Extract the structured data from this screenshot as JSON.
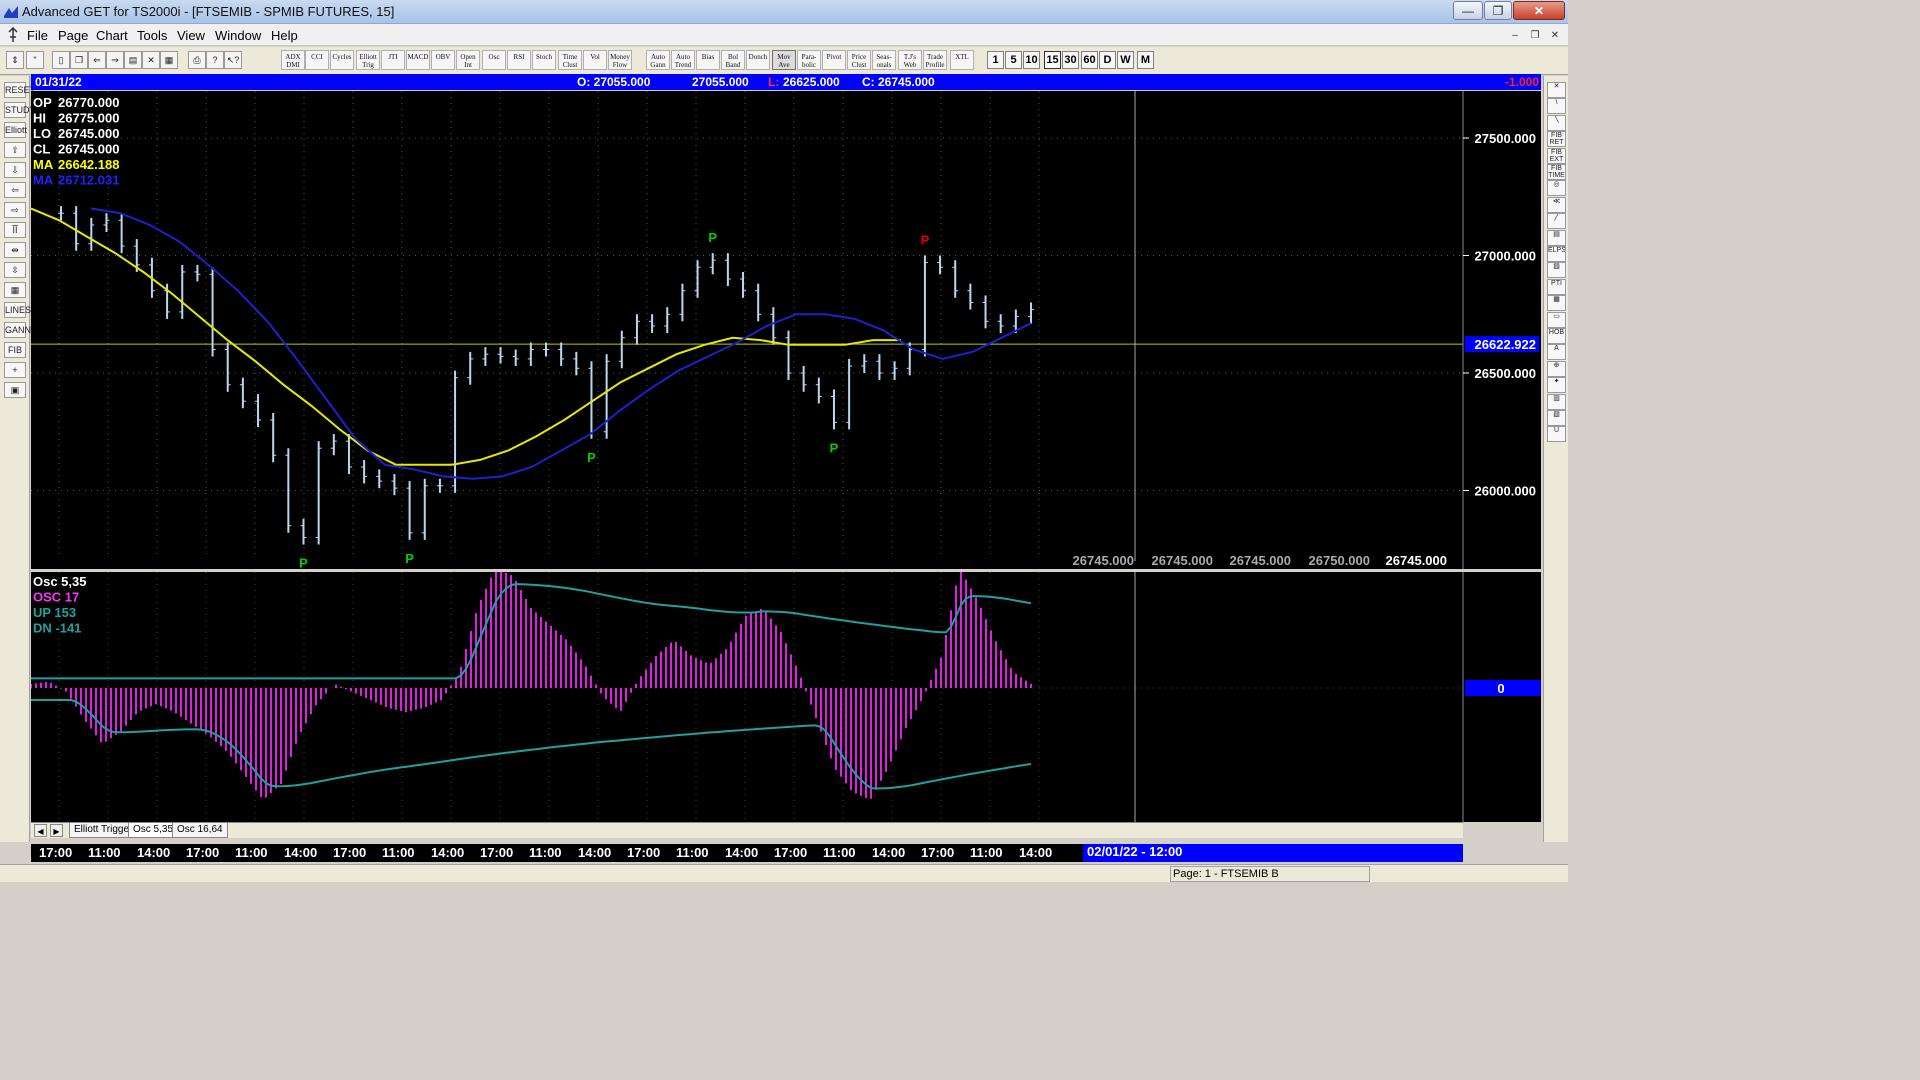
{
  "window": {
    "title": "Advanced GET for TS2000i - [FTSEMIB - SPMIB FUTURES, 15]",
    "minimize_label": "—",
    "maximize_label": "❐",
    "close_label": "✕"
  },
  "menu": {
    "items": [
      "File",
      "Page",
      "Chart",
      "Tools",
      "View",
      "Window",
      "Help"
    ],
    "mdi": [
      "–",
      "❐",
      "✕"
    ]
  },
  "toolbar": {
    "indicators": [
      "ADX DMI",
      "CCI",
      "Cycles",
      "Elliott Trig",
      "JTI",
      "MACD",
      "OBV",
      "Open Int",
      "Osc",
      "RSI",
      "Stoch",
      "Time Clust",
      "Vol",
      "Money Flow",
      "Auto Gann",
      "Auto Trend",
      "Bias",
      "Bol Band",
      "Donch",
      "Mov Ave",
      "Para-bolic",
      "Pivot",
      "Price Clust",
      "Seas-onals",
      "T.J's Web",
      "Trade Profile",
      "XTL"
    ],
    "active_indicator": "Mov Ave",
    "timeframes": [
      "1",
      "5",
      "10",
      "15",
      "30",
      "60",
      "D",
      "W",
      "M"
    ],
    "active_timeframe": "15"
  },
  "left_tools": [
    "RESET",
    "STUDY",
    "Elliott",
    "⇧",
    "⇩",
    "⇦",
    "⇨",
    "ĨĨ",
    "⇹",
    "⇳",
    "▦",
    "LINES",
    "GANN",
    "FIB",
    "+",
    "▣"
  ],
  "right_tools": [
    "✕",
    "\\",
    "╲",
    "FIB RET",
    "FIB EXT",
    "FIB TIME",
    "◎",
    "≪",
    "╱",
    "▤",
    "ELPS",
    "▨",
    "PTI",
    "▦",
    "▭",
    "HOB",
    "A",
    "⊕",
    "✦",
    "▥",
    "▧",
    "U"
  ],
  "infobar": {
    "date": "01/31/22",
    "open": "O: 27055.000",
    "high": "27055.000",
    "low_label": "L:",
    "low": "26625.000",
    "close": "C: 26745.000",
    "change": "-1.000",
    "change_color": "#ff2020"
  },
  "price_panel": {
    "legend": [
      {
        "label": "OP",
        "value": "26770.000",
        "color": "#ffffff"
      },
      {
        "label": "HI",
        "value": "26775.000",
        "color": "#ffffff"
      },
      {
        "label": "LO",
        "value": "26745.000",
        "color": "#ffffff"
      },
      {
        "label": "CL",
        "value": "26745.000",
        "color": "#ffffff"
      },
      {
        "label": "MA",
        "value": "26642.188",
        "color": "#ffff00"
      },
      {
        "label": "MA",
        "value": "26712.031",
        "color": "#2020ff"
      }
    ],
    "axis_labels": [
      "27500.000",
      "27000.000",
      "26500.000",
      "26000.000"
    ],
    "current_price": "26622.922",
    "bottom_values": [
      "26745.000",
      "26745.000",
      "26745.000",
      "26750.000",
      "26745.000"
    ],
    "pivots": [
      {
        "label": "P",
        "color": "#00d000"
      },
      {
        "label": "P",
        "color": "#00d000"
      },
      {
        "label": "P",
        "color": "#00d000"
      },
      {
        "label": "P",
        "color": "#00d000"
      },
      {
        "label": "P",
        "color": "#00d000"
      },
      {
        "label": "P",
        "color": "#e00000"
      }
    ]
  },
  "osc_panel": {
    "legend": [
      {
        "label": "Osc 5,35",
        "color": "#ffffff"
      },
      {
        "label": "OSC 17",
        "color": "#ff33ff"
      },
      {
        "label": "UP   153",
        "color": "#20a0a0"
      },
      {
        "label": "DN   -141",
        "color": "#20a0a0"
      }
    ],
    "zero_label": "0",
    "colors": {
      "histogram": "#e020e0",
      "bands": "#20a0a0"
    }
  },
  "tabs": {
    "nav": [
      "◀",
      "▶"
    ],
    "items": [
      "Elliott Trigger",
      "Osc 5,35",
      "Osc 16,64"
    ],
    "active": "Osc 5,35"
  },
  "time_axis": {
    "labels": [
      "17:00",
      "11:00",
      "14:00",
      "17:00",
      "11:00",
      "14:00",
      "17:00",
      "11:00",
      "14:00",
      "17:00",
      "11:00",
      "14:00",
      "17:00",
      "11:00",
      "14:00",
      "17:00",
      "11:00",
      "14:00",
      "17:00",
      "11:00",
      "14:00"
    ],
    "cursor_time": "02/01/22 - 12:00"
  },
  "status": {
    "page": "Page: 1 - FTSEMIB B"
  },
  "chart_data": {
    "type": "bar",
    "title": "FTSEMIB - SPMIB FUTURES, 15",
    "ylim": [
      25700,
      27700
    ],
    "current_price": 26622.922,
    "ma_yellow_last": 26642.188,
    "ma_blue_last": 26712.031,
    "series": [
      {
        "name": "Price",
        "values": [
          27180,
          27050,
          27130,
          27150,
          27040,
          26960,
          26850,
          26760,
          26930,
          26920,
          26600,
          26450,
          26380,
          26300,
          26150,
          25850,
          25800,
          26180,
          26210,
          26100,
          26060,
          26040,
          26010,
          25820,
          26020,
          26020,
          26480,
          26560,
          26580,
          26570,
          26560,
          26600,
          26600,
          26560,
          26520,
          26250,
          26550,
          26650,
          26720,
          26700,
          26750,
          26850,
          26950,
          26980,
          26900,
          26850,
          26750,
          26650,
          26500,
          26450,
          26400,
          26290,
          26530,
          26550,
          26500,
          26520,
          26600,
          26970,
          26950,
          26850,
          26800,
          26720,
          26700,
          26740,
          26770
        ]
      },
      {
        "name": "MA",
        "values": [
          27200,
          27150,
          27080,
          27010,
          26930,
          26840,
          26740,
          26640,
          26550,
          26450,
          26360,
          26260,
          26170,
          26110,
          26110,
          26110,
          26130,
          26170,
          26230,
          26300,
          26380,
          26460,
          26520,
          26580,
          26620,
          26650,
          26640,
          26620,
          26620,
          26620,
          26640,
          26640
        ]
      },
      {
        "name": "MA",
        "values": [
          27200,
          27180,
          27130,
          27060,
          26960,
          26850,
          26720,
          26560,
          26390,
          26220,
          26110,
          26090,
          26060,
          26050,
          26060,
          26100,
          26170,
          26240,
          26340,
          26430,
          26510,
          26570,
          26630,
          26700,
          26750,
          26750,
          26730,
          26680,
          26600,
          26560,
          26590,
          26650,
          26712
        ]
      }
    ],
    "oscillator": {
      "name": "Osc 5,35",
      "values": [
        5,
        8,
        -5,
        -40,
        -70,
        -55,
        -30,
        -20,
        -30,
        -45,
        -60,
        -80,
        -110,
        -140,
        -120,
        -60,
        -20,
        5,
        -5,
        -15,
        -25,
        -30,
        -25,
        -15,
        20,
        100,
        150,
        140,
        100,
        80,
        60,
        30,
        -10,
        -30,
        10,
        40,
        60,
        40,
        30,
        50,
        90,
        100,
        70,
        20,
        -40,
        -100,
        -130,
        -140,
        -100,
        -50,
        -10,
        40,
        150,
        110,
        60,
        20,
        5
      ],
      "up_band_value": 153,
      "dn_band_value": -141
    }
  }
}
